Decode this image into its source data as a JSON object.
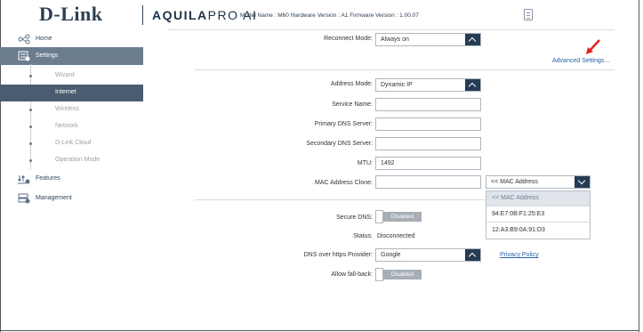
{
  "header": {
    "logo": "D-Link",
    "brand_bold": "AQUILA",
    "brand_pro": "PRO",
    "brand_ai": "AI",
    "model_info": "Model Name : M60 Hardware Version : A1 Firmware Version : 1.00.07",
    "icon": "document-icon"
  },
  "sidebar": {
    "home": "Home",
    "settings": "Settings",
    "sub_items": [
      "Wizard",
      "Internet",
      "Wireless",
      "Network",
      "D-Link Cloud",
      "Operation Mode"
    ],
    "active_sub": "Internet",
    "features": "Features",
    "management": "Management"
  },
  "internet": {
    "reconnect_mode_label": "Reconnect Mode:",
    "reconnect_mode_value": "Always on",
    "advanced_settings": "Advanced Settings...",
    "address_mode_label": "Address Mode:",
    "address_mode_value": "Dynamic IP",
    "service_name_label": "Service Name:",
    "service_name_value": "",
    "primary_dns_label": "Primary DNS Server:",
    "primary_dns_value": "",
    "secondary_dns_label": "Secondary DNS Server:",
    "secondary_dns_value": "",
    "mtu_label": "MTU:",
    "mtu_value": "1492",
    "mac_clone_label": "MAC Address Clone:",
    "mac_clone_value": "",
    "mac_select_value": "<< MAC Address",
    "mac_options": [
      "<< MAC Address",
      "94:E7:0B:F1:25:E3",
      "12:A3:B9:0A:91:D3"
    ],
    "secure_dns_label": "Secure DNS:",
    "secure_dns_state": "Disabled",
    "status_label": "Status:",
    "status_value": "Disconnected",
    "doh_provider_label": "DNS over https Provider:",
    "doh_provider_value": "Google",
    "privacy_policy": "Privacy Policy",
    "fallback_label": "Allow fall-back:",
    "fallback_state": "Disabled"
  },
  "colors": {
    "navy": "#263c55",
    "sidebar_active": "#6b7c8f",
    "sub_active": "#4a5c70",
    "link": "#2a62a8",
    "annotation_arrow": "#e0231c"
  }
}
